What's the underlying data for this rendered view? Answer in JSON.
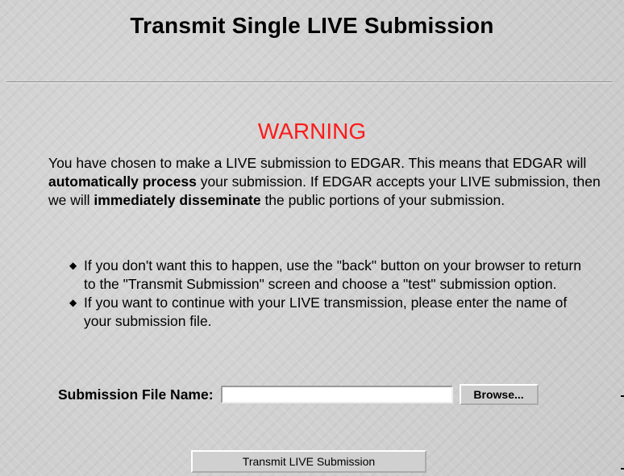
{
  "page": {
    "title": "Transmit Single LIVE Submission"
  },
  "warning": {
    "heading": "WARNING",
    "paragraph": [
      {
        "text": "You have chosen to make a LIVE submission to EDGAR. This means that EDGAR will ",
        "bold": false
      },
      {
        "text": "automatically process",
        "bold": true
      },
      {
        "text": " your submission. If EDGAR accepts your LIVE submission, then we will ",
        "bold": false
      },
      {
        "text": "immediately disseminate",
        "bold": true
      },
      {
        "text": " the public portions of your submission.",
        "bold": false
      }
    ]
  },
  "instructions": [
    "If you don't want this to happen, use the \"back\" button on your browser to return to the \"Transmit Submission\" screen and choose a \"test\" submission option.",
    "If you want to continue with your LIVE transmission, please enter the name of your submission file."
  ],
  "file_field": {
    "label": "Submission File Name:",
    "value": "",
    "placeholder": "",
    "browse_label": "Browse..."
  },
  "submit": {
    "label": "Transmit LIVE Submission"
  },
  "icons": {
    "bullet": "bullet-icon"
  },
  "colors": {
    "warning": "#ff1a1a",
    "background": "#cfcfcf"
  }
}
